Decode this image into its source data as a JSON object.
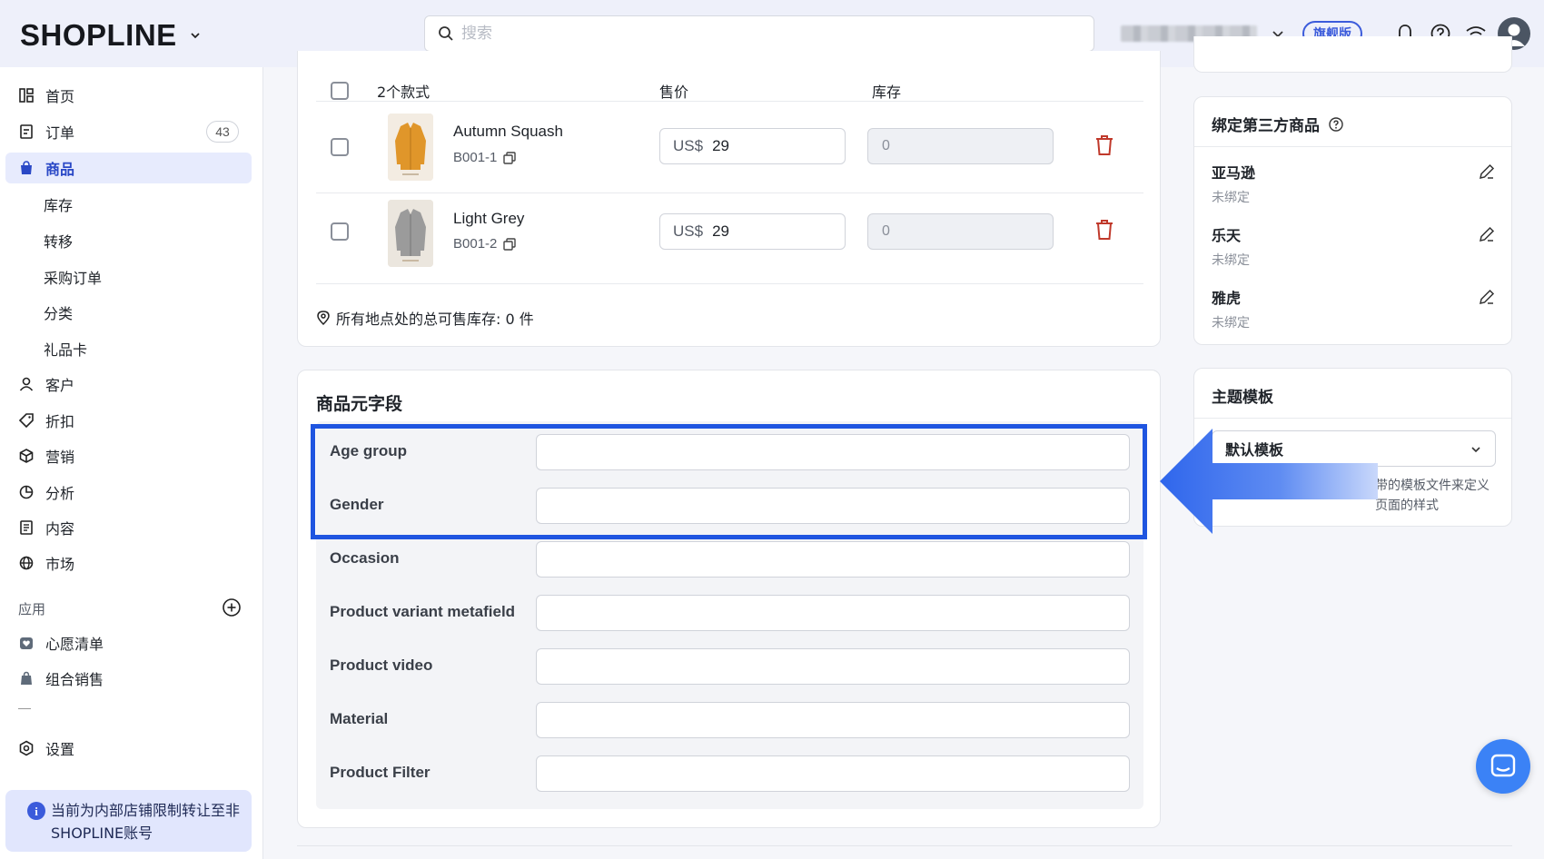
{
  "topbar": {
    "logo": "SHOPLINE",
    "search_placeholder": "搜索",
    "plan_badge": "旗舰版"
  },
  "sidebar": {
    "items": [
      {
        "label": "首页",
        "icon": "dashboard-icon"
      },
      {
        "label": "订单",
        "icon": "order-icon",
        "badge": "43"
      },
      {
        "label": "商品",
        "icon": "product-bag-icon",
        "active": true
      },
      {
        "label": "库存"
      },
      {
        "label": "转移"
      },
      {
        "label": "采购订单"
      },
      {
        "label": "分类"
      },
      {
        "label": "礼品卡"
      },
      {
        "label": "客户",
        "icon": "user-icon"
      },
      {
        "label": "折扣",
        "icon": "tag-icon"
      },
      {
        "label": "营销",
        "icon": "cube-icon"
      },
      {
        "label": "分析",
        "icon": "chart-pie-icon"
      },
      {
        "label": "内容",
        "icon": "document-icon"
      },
      {
        "label": "市场",
        "icon": "globe-icon"
      }
    ],
    "apps_label": "应用",
    "apps": [
      {
        "label": "心愿清单",
        "icon": "wishlist-app-icon"
      },
      {
        "label": "组合销售",
        "icon": "bundle-app-icon"
      }
    ],
    "settings_label": "设置",
    "notice": "当前为内部店铺限制转让至非SHOPLINE账号"
  },
  "variants": {
    "header_count": "2个款式",
    "price_header": "售价",
    "stock_header": "库存",
    "rows": [
      {
        "name": "Autumn Squash",
        "sku": "B001-1",
        "currency": "US$",
        "price": "29",
        "stock": "0"
      },
      {
        "name": "Light Grey",
        "sku": "B001-2",
        "currency": "US$",
        "price": "29",
        "stock": "0"
      }
    ],
    "total_stock": "所有地点处的总可售库存:  0 件"
  },
  "metafields": {
    "title": "商品元字段",
    "fields": [
      {
        "label": "Age group",
        "value": ""
      },
      {
        "label": "Gender",
        "value": ""
      },
      {
        "label": "Occasion",
        "value": ""
      },
      {
        "label": "Product variant metafield",
        "value": ""
      },
      {
        "label": "Product video",
        "value": ""
      },
      {
        "label": "Material",
        "value": ""
      },
      {
        "label": "Product Filter",
        "value": ""
      }
    ]
  },
  "third_party": {
    "title": "绑定第三方商品",
    "items": [
      {
        "name": "亚马逊",
        "status": "未绑定"
      },
      {
        "name": "乐天",
        "status": "未绑定"
      },
      {
        "name": "雅虎",
        "status": "未绑定"
      }
    ]
  },
  "theme_template": {
    "title": "主题模板",
    "selected": "默认模板",
    "desc": "带的模板文件来定义页面的样式"
  },
  "colors": {
    "accent": "#3b5bdb",
    "highlight": "#1f55e0",
    "danger": "#c0392b"
  }
}
